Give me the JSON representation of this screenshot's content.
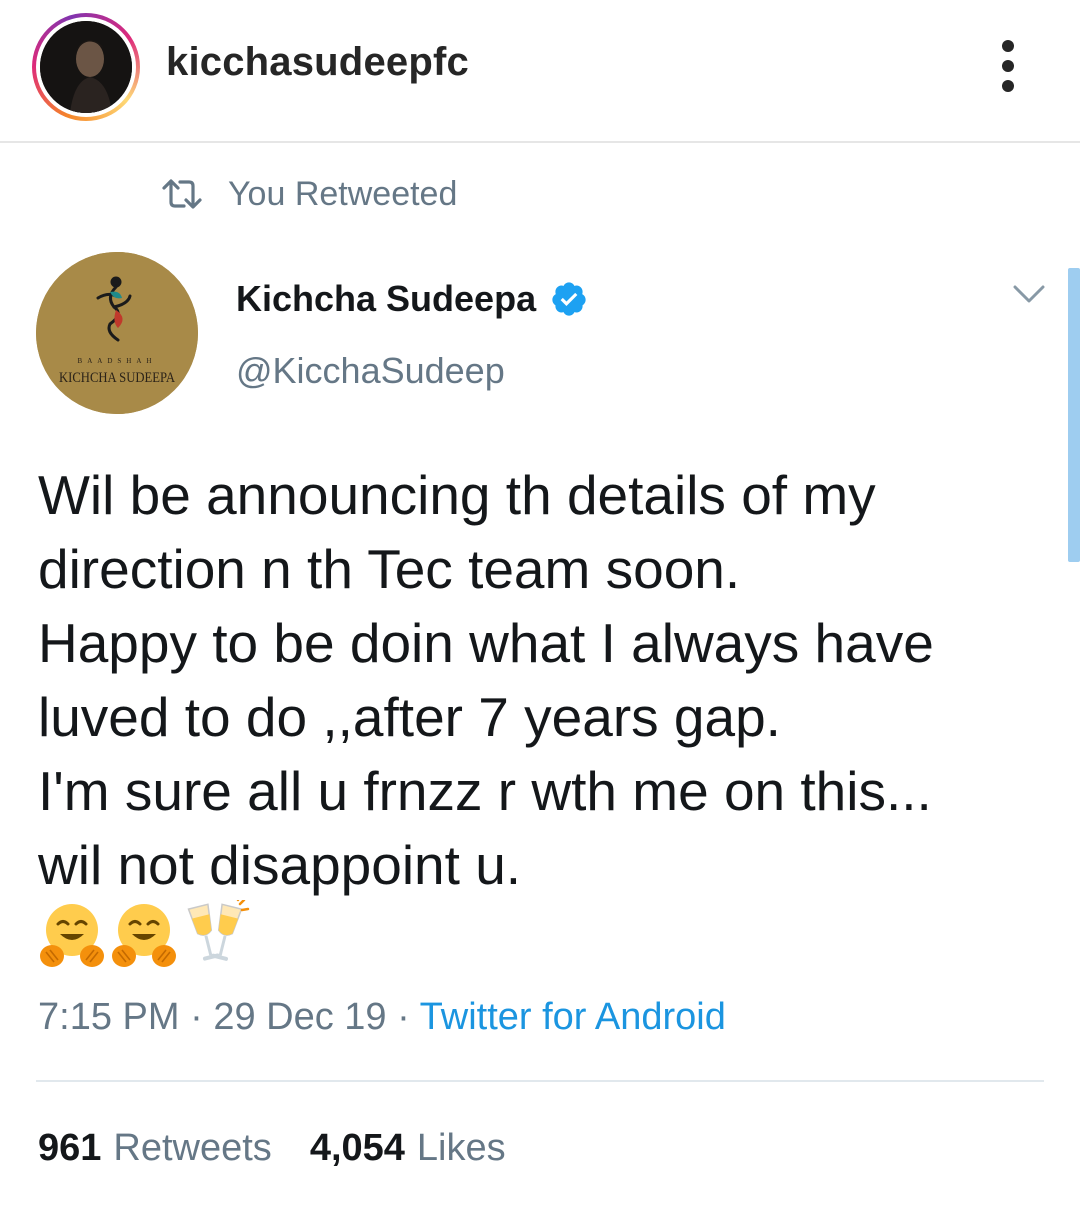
{
  "instagram": {
    "username": "kicchasudeepfc",
    "avatar_icon": "profile-photo",
    "more_icon": "more-vertical-icon"
  },
  "retweet_context": {
    "icon": "retweet-icon",
    "label": "You Retweeted"
  },
  "tweet": {
    "author_name": "Kichcha Sudeepa",
    "verified_icon": "verified-badge-icon",
    "handle": "@KicchaSudeep",
    "avatar_logo": {
      "top_text": "BAADSHAH",
      "bottom_text": "KICHCHA SUDEEPA"
    },
    "text_lines": [
      "Wil be announcing th details of my",
      "direction n th Tec team soon.",
      "Happy to be doin what I always have",
      "luved to do ,,after 7 years gap.",
      "I'm sure all u frnzz r wth me on this...",
      "wil not disappoint u."
    ],
    "emojis": [
      "hugging-face",
      "hugging-face",
      "clinking-glasses"
    ],
    "time": "7:15 PM",
    "date": "29 Dec 19",
    "separator": "·",
    "source": "Twitter for Android",
    "retweets_count": "961",
    "retweets_label": "Retweets",
    "likes_count": "4,054",
    "likes_label": "Likes"
  },
  "colors": {
    "text_primary": "#14171a",
    "text_secondary": "#657786",
    "link": "#1b95e0",
    "verified": "#1da1f2",
    "avatar_bg": "#a88a48"
  }
}
